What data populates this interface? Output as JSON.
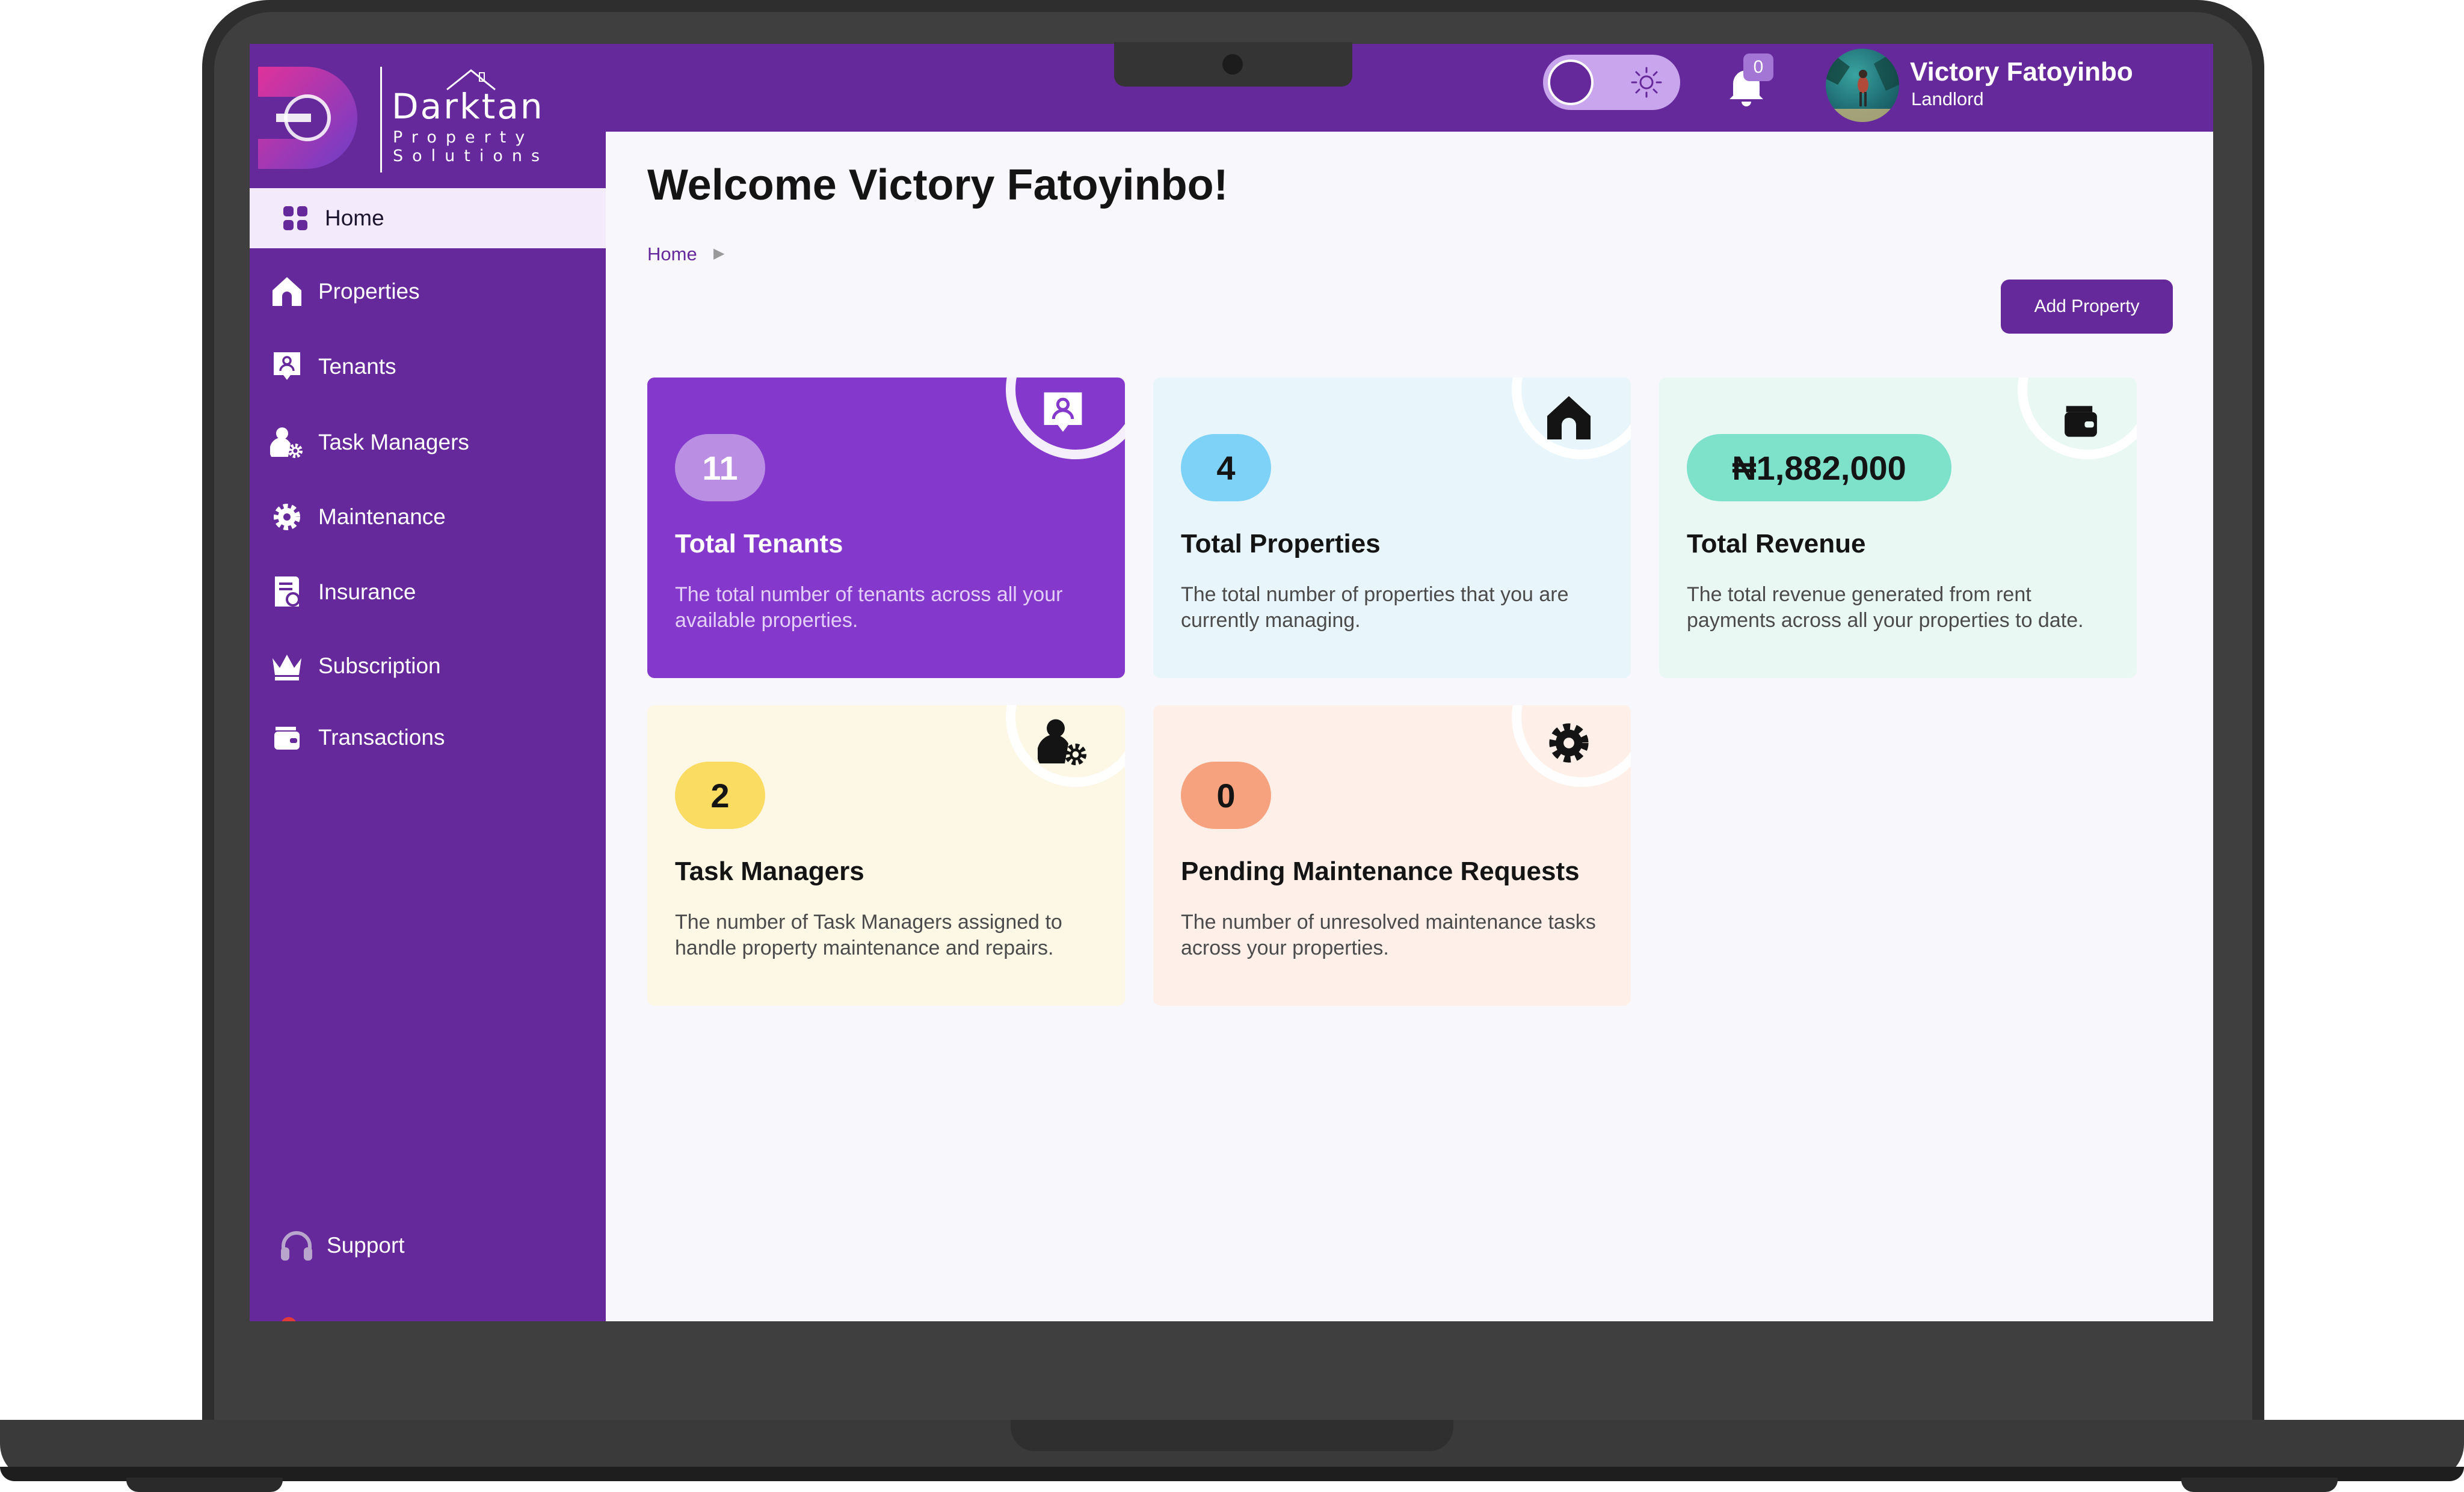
{
  "brand": {
    "name": "Darktan",
    "tagline_line1": "Property",
    "tagline_line2": "Solutions"
  },
  "sidebar": {
    "items": [
      {
        "label": "Home",
        "icon": "grid-icon",
        "active": true
      },
      {
        "label": "Properties",
        "icon": "home-icon"
      },
      {
        "label": "Tenants",
        "icon": "tenant-badge-icon"
      },
      {
        "label": "Task Managers",
        "icon": "user-gear-icon"
      },
      {
        "label": "Maintenance",
        "icon": "gear-icon"
      },
      {
        "label": "Insurance",
        "icon": "document-shield-icon"
      },
      {
        "label": "Subscription",
        "icon": "crown-icon"
      },
      {
        "label": "Transactions",
        "icon": "wallet-icon"
      }
    ],
    "support_label": "Support"
  },
  "header": {
    "notifications_count": "0",
    "user_name": "Victory Fatoyinbo",
    "user_role": "Landlord",
    "theme_toggle": "light"
  },
  "main": {
    "welcome": "Welcome Victory Fatoyinbo!",
    "breadcrumb": "Home",
    "add_property_label": "Add Property",
    "cards": [
      {
        "count": "11",
        "title": "Total Tenants",
        "desc": "The total number of tenants across all your available properties.",
        "icon": "tenant-badge-icon"
      },
      {
        "count": "4",
        "title": "Total Properties",
        "desc": "The total number of properties that you are currently managing.",
        "icon": "home-icon"
      },
      {
        "count": "₦1,882,000",
        "title": "Total Revenue",
        "desc": "The total revenue generated from rent payments across all your properties to date.",
        "icon": "wallet-icon"
      },
      {
        "count": "2",
        "title": "Task Managers",
        "desc": "The number of Task Managers assigned to handle property maintenance and repairs.",
        "icon": "user-gear-icon"
      },
      {
        "count": "0",
        "title": "Pending Maintenance Requests",
        "desc": "The number of unresolved maintenance tasks across your properties.",
        "icon": "gear-icon"
      }
    ]
  },
  "colors": {
    "brand_purple": "#66299b",
    "card_tenants": "#8438cc",
    "card_properties": "#e8f6fc",
    "card_revenue": "#e9f8f3",
    "card_task_managers": "#fdf7e5",
    "card_maintenance": "#fef0e9"
  }
}
